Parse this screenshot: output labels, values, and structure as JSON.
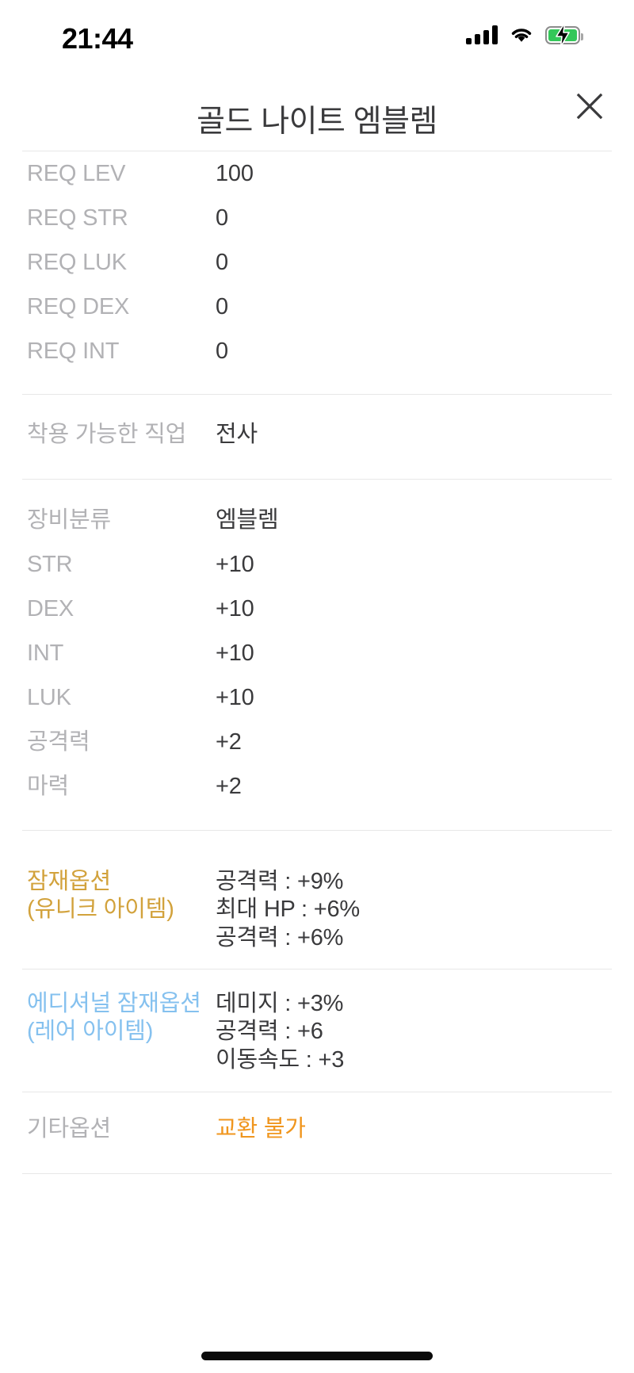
{
  "status_bar": {
    "time": "21:44",
    "cellular_icon": "cellular-signal-icon",
    "wifi_icon": "wifi-icon",
    "battery_icon": "battery-charging-icon"
  },
  "header": {
    "title": "골드 나이트 엠블렘",
    "close_icon": "close-x-icon"
  },
  "colors": {
    "label_gray": "#b2b2b5",
    "value_dark": "#3a3a3c",
    "gold": "#d2a23c",
    "blue": "#85c1ef",
    "orange": "#f0961e",
    "divider": "#e8e8e8",
    "battery_green": "#34c759"
  },
  "sections": [
    {
      "name": "requirements",
      "rows": [
        {
          "label": "REQ LEV",
          "value": "100"
        },
        {
          "label": "REQ STR",
          "value": "0"
        },
        {
          "label": "REQ LUK",
          "value": "0"
        },
        {
          "label": "REQ DEX",
          "value": "0"
        },
        {
          "label": "REQ INT",
          "value": "0"
        }
      ]
    },
    {
      "name": "job",
      "rows": [
        {
          "label": "착용 가능한 직업",
          "value": "전사"
        }
      ]
    },
    {
      "name": "equipment",
      "rows": [
        {
          "label": "장비분류",
          "value": "엠블렘"
        },
        {
          "label": "STR",
          "value": "+10"
        },
        {
          "label": "DEX",
          "value": "+10"
        },
        {
          "label": "INT",
          "value": "+10"
        },
        {
          "label": "LUK",
          "value": "+10"
        },
        {
          "label": "공격력",
          "value": "+2"
        },
        {
          "label": "마력",
          "value": "+2"
        }
      ]
    },
    {
      "name": "potential",
      "label_main": "잠재옵션",
      "label_sub": "(유니크 아이템)",
      "lines": [
        "공격력 : +9%",
        "최대 HP : +6%",
        "공격력 : +6%"
      ]
    },
    {
      "name": "additional_potential",
      "label_main": "에디셔널 잠재옵션",
      "label_sub": "(레어 아이템)",
      "lines": [
        "데미지 : +3%",
        "공격력 : +6",
        "이동속도 : +3"
      ]
    },
    {
      "name": "other",
      "label": "기타옵션",
      "value": "교환 불가"
    }
  ]
}
